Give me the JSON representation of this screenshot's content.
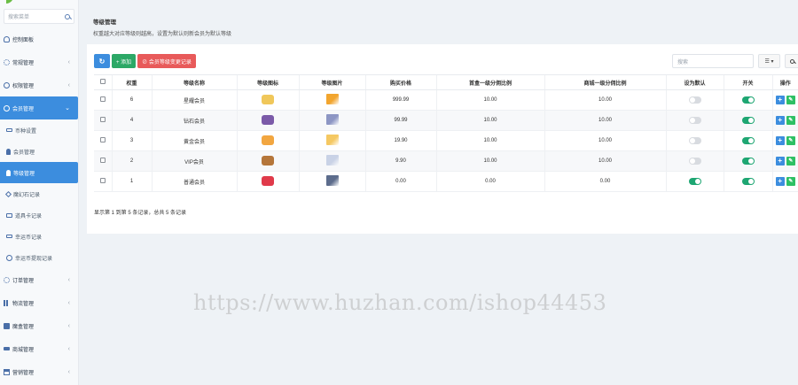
{
  "sidebar": {
    "search_placeholder": "搜索菜单",
    "items": [
      {
        "label": "控制面板",
        "icon": "dashboard-icon",
        "chevron": ""
      },
      {
        "label": "常规管理",
        "icon": "gear-icon",
        "chevron": "‹"
      },
      {
        "label": "权限管理",
        "icon": "power-icon",
        "chevron": "‹"
      },
      {
        "label": "会员管理",
        "icon": "user-icon",
        "chevron": "⌄"
      },
      {
        "label": "币种设置",
        "icon": "tag-icon"
      },
      {
        "label": "会员管理",
        "icon": "person-icon"
      },
      {
        "label": "等级管理",
        "icon": "level-icon"
      },
      {
        "label": "魔幻石记录",
        "icon": "diamond-icon"
      },
      {
        "label": "道具卡记录",
        "icon": "card-icon"
      },
      {
        "label": "幸运币记录",
        "icon": "tag-icon"
      },
      {
        "label": "幸运币提现记录",
        "icon": "coin-icon"
      },
      {
        "label": "订单管理",
        "icon": "gear-icon",
        "chevron": "‹"
      },
      {
        "label": "物流管理",
        "icon": "bars-icon",
        "chevron": "‹"
      },
      {
        "label": "魔盒管理",
        "icon": "box-icon",
        "chevron": "‹"
      },
      {
        "label": "商城管理",
        "icon": "truck-icon",
        "chevron": "‹"
      },
      {
        "label": "营销管理",
        "icon": "shop-icon",
        "chevron": "‹"
      }
    ]
  },
  "page": {
    "title": "等级管理",
    "subtitle": "权重越大对应等级则越高，设置为默认则新会员为默认等级"
  },
  "toolbar": {
    "refresh_label": "↻",
    "add_label": "+ 添加",
    "log_label": "⊘ 会员等级变更记录",
    "search_placeholder": "搜索",
    "columns_label": "☰ ▾"
  },
  "table": {
    "headers": [
      "",
      "权重",
      "等级名称",
      "等级图标",
      "等级图片",
      "购买价格",
      "首盒一级分佣比例",
      "商城一级分佣比例",
      "设为默认",
      "开关",
      "操作"
    ],
    "rows": [
      {
        "weight": "6",
        "name": "星耀会员",
        "icon_color": "#f0c75a",
        "img_color": "#f2a52e",
        "price": "999.99",
        "box_ratio": "10.00",
        "mall_ratio": "10.00",
        "default": false,
        "switch": true
      },
      {
        "weight": "4",
        "name": "钻石会员",
        "icon_color": "#7b5aa8",
        "img_color": "#8d96c4",
        "price": "99.99",
        "box_ratio": "10.00",
        "mall_ratio": "10.00",
        "default": false,
        "switch": true
      },
      {
        "weight": "3",
        "name": "黄金会员",
        "icon_color": "#f2a640",
        "img_color": "#f5c862",
        "price": "19.90",
        "box_ratio": "10.00",
        "mall_ratio": "10.00",
        "default": false,
        "switch": true
      },
      {
        "weight": "2",
        "name": "VIP会员",
        "icon_color": "#b5763a",
        "img_color": "#c9d2e6",
        "price": "9.90",
        "box_ratio": "10.00",
        "mall_ratio": "10.00",
        "default": false,
        "switch": true
      },
      {
        "weight": "1",
        "name": "普通会员",
        "icon_color": "#e03a4a",
        "img_color": "#5c6c8c",
        "price": "0.00",
        "box_ratio": "0.00",
        "mall_ratio": "0.00",
        "default": true,
        "switch": true
      }
    ]
  },
  "pagination_info": "显示第 1 到第 5 条记录，总共 5 条记录",
  "watermark": "https://www.huzhan.com/ishop44453"
}
